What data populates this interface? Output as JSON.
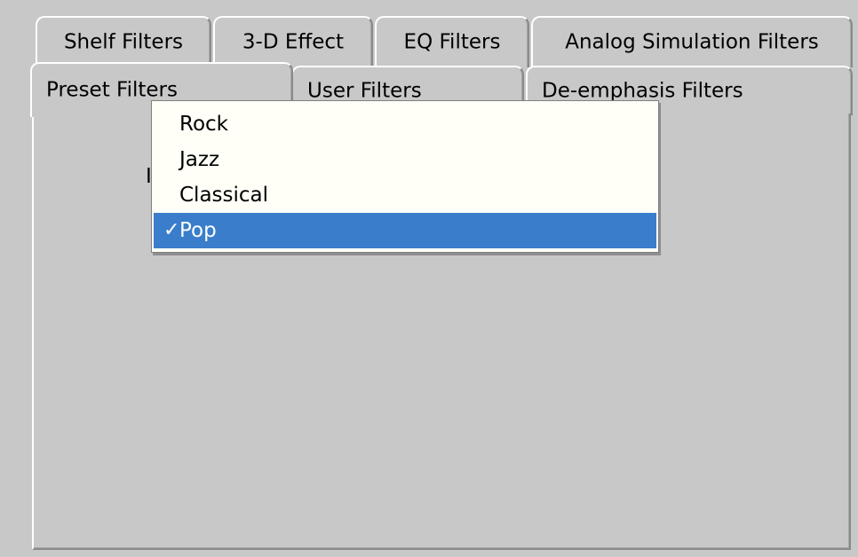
{
  "tabs_back_row": [
    {
      "label": "Shelf Filters"
    },
    {
      "label": "3-D Effect"
    },
    {
      "label": "EQ Filters"
    },
    {
      "label": "Analog Simulation Filters"
    }
  ],
  "tabs_front_row": [
    {
      "label": "Preset Filters",
      "active": true
    },
    {
      "label": "User Filters",
      "active": false
    },
    {
      "label": "De-emphasis Filters",
      "active": false
    }
  ],
  "hidden_label_fragment": "I",
  "preset_menu": {
    "items": [
      {
        "label": "Rock",
        "checked": false
      },
      {
        "label": "Jazz",
        "checked": false
      },
      {
        "label": "Classical",
        "checked": false
      },
      {
        "label": "Pop",
        "checked": true
      }
    ],
    "selected": "Pop",
    "check_glyph": "✓",
    "highlight_color": "#3a7dcb"
  },
  "colors": {
    "panel_bg": "#c8c8c8",
    "menu_bg": "#fffff8"
  }
}
